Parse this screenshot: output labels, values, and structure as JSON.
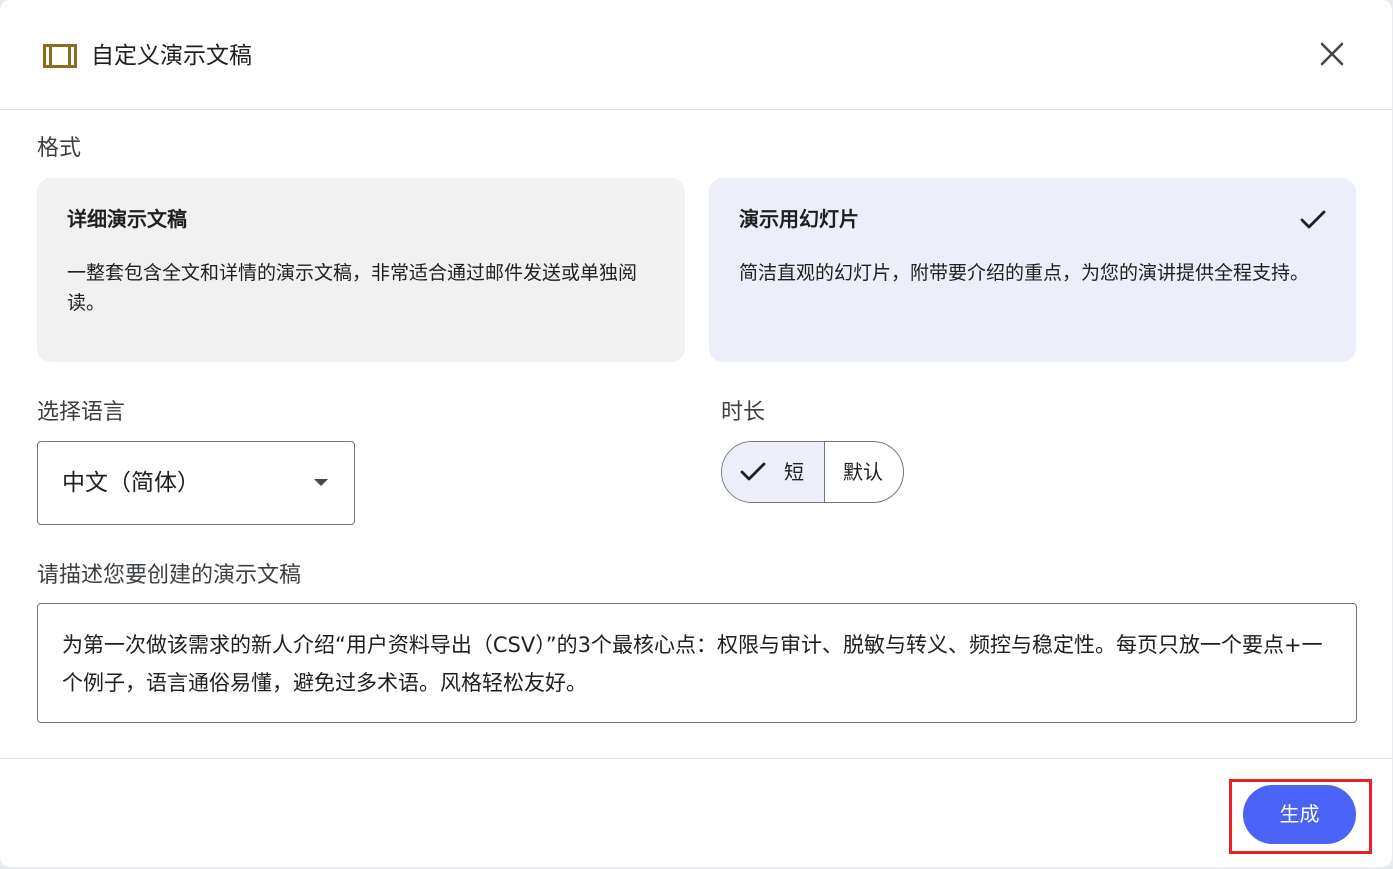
{
  "dialog": {
    "title": "自定义演示文稿",
    "close_icon": "close-icon",
    "title_icon": "presentation-icon"
  },
  "format": {
    "label": "格式",
    "options": [
      {
        "title": "详细演示文稿",
        "description": "一整套包含全文和详情的演示文稿，非常适合通过邮件发送或单独阅读。",
        "selected": false
      },
      {
        "title": "演示用幻灯片",
        "description": "简洁直观的幻灯片，附带要介绍的重点，为您的演讲提供全程支持。",
        "selected": true
      }
    ]
  },
  "language": {
    "label": "选择语言",
    "selected": "中文（简体）"
  },
  "duration": {
    "label": "时长",
    "options": [
      {
        "label": "短",
        "selected": true
      },
      {
        "label": "默认",
        "selected": false
      }
    ]
  },
  "prompt": {
    "label": "请描述您要创建的演示文稿",
    "value": "为第一次做该需求的新人介绍“用户资料导出（CSV）”的3个最核心点：权限与审计、脱敏与转义、频控与稳定性。每页只放一个要点+一个例子，语言通俗易懂，避免过多术语。风格轻松友好。"
  },
  "actions": {
    "generate_label": "生成"
  },
  "colors": {
    "accent": "#4a62f5",
    "selected_card": "#eceef9",
    "unselected_card": "#f1f1f1",
    "highlight": "#e8202a",
    "title_icon": "#8a6d1f"
  }
}
